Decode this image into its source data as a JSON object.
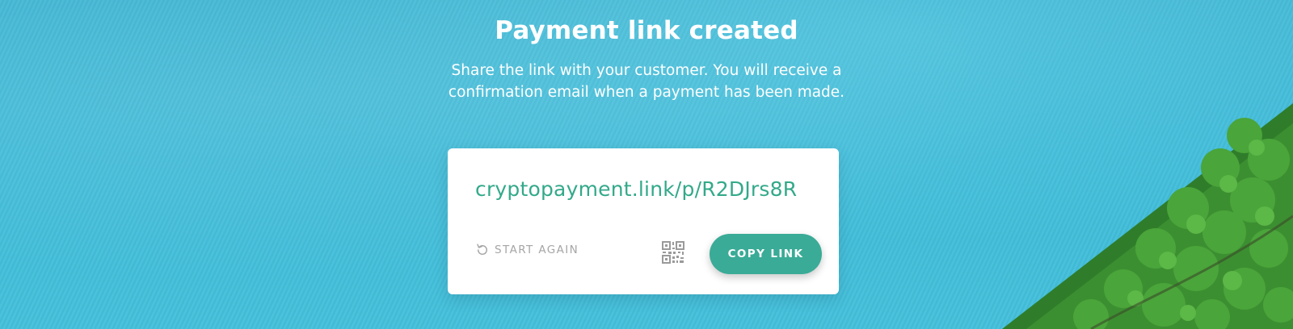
{
  "header": {
    "title": "Payment link created",
    "subtitle": "Share the link with your customer. You will receive a confirmation email when a payment has been made."
  },
  "card": {
    "link": "cryptopayment.link/p/R2DJrs8R",
    "start_again_label": "START AGAIN",
    "start_again_icon": "refresh-icon",
    "qr_icon": "qr-code-icon",
    "copy_button_label": "COPY LINK"
  },
  "colors": {
    "accent": "#3aab97",
    "link_text": "#33a98a",
    "secondary_text": "#a6a6a6",
    "background_water": "#45bcd8"
  }
}
